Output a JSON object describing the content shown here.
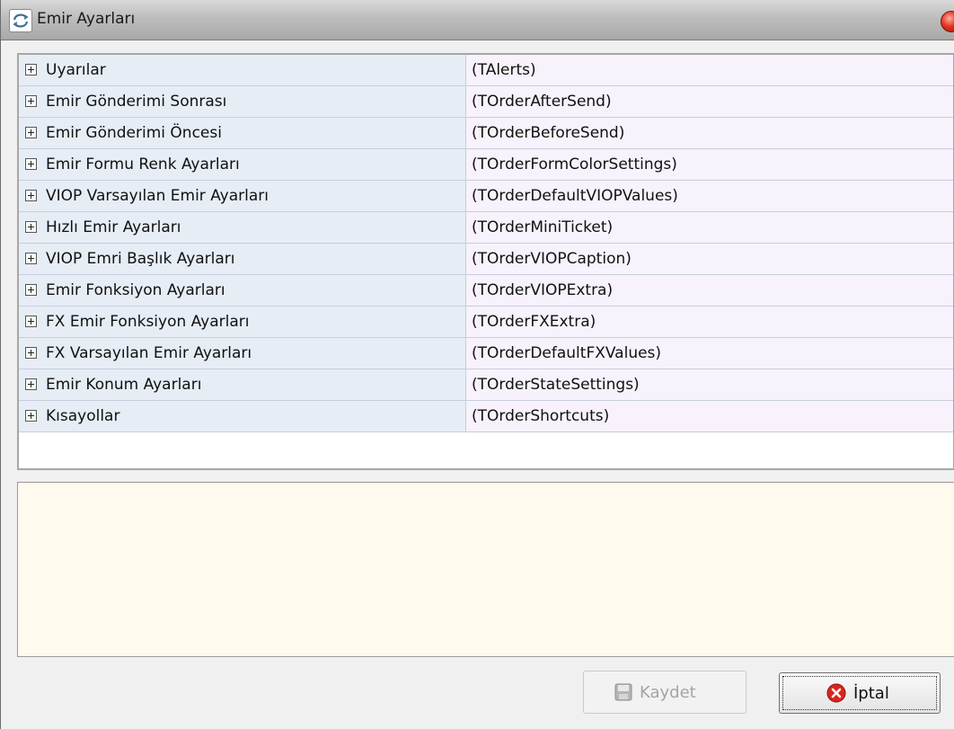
{
  "window": {
    "title": "Emir Ayarları"
  },
  "settings": [
    {
      "name": "Uyarılar",
      "value": "(TAlerts)"
    },
    {
      "name": "Emir Gönderimi Sonrası",
      "value": "(TOrderAfterSend)"
    },
    {
      "name": "Emir Gönderimi Öncesi",
      "value": "(TOrderBeforeSend)"
    },
    {
      "name": "Emir Formu Renk Ayarları",
      "value": "(TOrderFormColorSettings)"
    },
    {
      "name": "VIOP Varsayılan Emir Ayarları",
      "value": "(TOrderDefaultVIOPValues)"
    },
    {
      "name": "Hızlı Emir Ayarları",
      "value": "(TOrderMiniTicket)"
    },
    {
      "name": "VIOP Emri Başlık Ayarları",
      "value": "(TOrderVIOPCaption)"
    },
    {
      "name": "Emir Fonksiyon Ayarları",
      "value": "(TOrderVIOPExtra)"
    },
    {
      "name": "FX Emir Fonksiyon Ayarları",
      "value": "(TOrderFXExtra)"
    },
    {
      "name": "FX Varsayılan Emir Ayarları",
      "value": "(TOrderDefaultFXValues)"
    },
    {
      "name": "Emir Konum Ayarları",
      "value": "(TOrderStateSettings)"
    },
    {
      "name": "Kısayollar",
      "value": "(TOrderShortcuts)"
    }
  ],
  "buttons": {
    "save_label": "Kaydet",
    "cancel_label": "İptal"
  },
  "icons": {
    "app": "app-logo-icon",
    "close": "close-icon",
    "expand": "expand-plus-icon",
    "save": "floppy-disk-icon",
    "cancel": "cancel-x-icon"
  },
  "colors": {
    "grid_name_bg": "#e6edf5",
    "grid_value_bg": "#f7f2fb",
    "description_bg": "#fffaee",
    "close_red": "#e4341f"
  }
}
